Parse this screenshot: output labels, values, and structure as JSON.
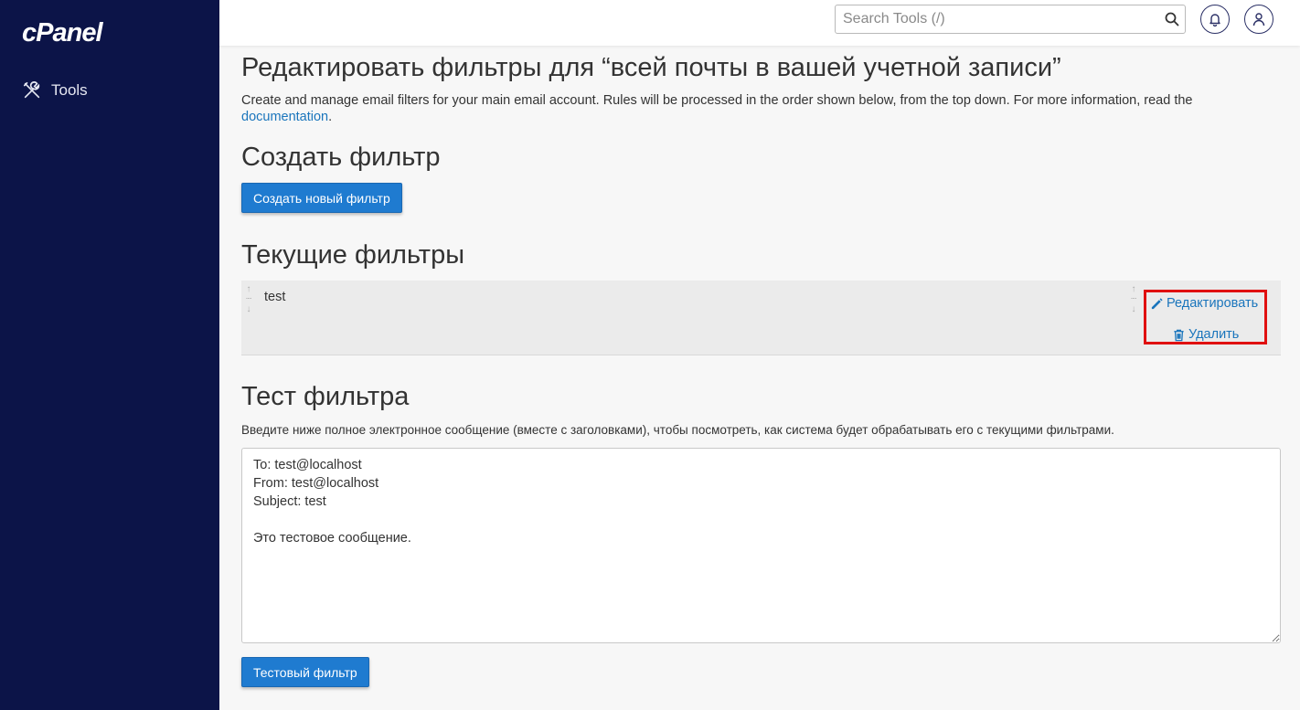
{
  "sidebar": {
    "logo": "cPanel",
    "items": [
      {
        "label": "Tools",
        "icon": "tools-icon"
      }
    ]
  },
  "header": {
    "search": {
      "placeholder": "Search Tools (/)",
      "icon": "search-icon"
    },
    "notifications_icon": "bell-icon",
    "user_icon": "user-icon"
  },
  "main": {
    "title": "Редактировать фильтры для “всей почты в вашей учетной записи”",
    "description": "Create and manage email filters for your main email account. Rules will be processed in the order shown below, from the top down. For more information, read the ",
    "doc_link": "documentation",
    "description_end": ".",
    "create_section": {
      "heading": "Создать фильтр",
      "button": "Создать новый фильтр"
    },
    "current_section": {
      "heading": "Текущие фильтры",
      "filters": [
        {
          "name": "test",
          "edit_label": "Редактировать",
          "delete_label": "Удалить"
        }
      ]
    },
    "test_section": {
      "heading": "Тест фильтра",
      "description": "Введите ниже полное электронное сообщение (вместе с заголовками), чтобы посмотреть, как система будет обрабатывать его с текущими фильтрами.",
      "message": "To: test@localhost\nFrom: test@localhost\nSubject: test\n\nЭто тестовое сообщение.",
      "button": "Тестовый фильтр"
    }
  },
  "colors": {
    "sidebar_bg": "#0c1448",
    "primary_button": "#1f7bd0",
    "link": "#1a75bc",
    "highlight_border": "#e01010"
  }
}
